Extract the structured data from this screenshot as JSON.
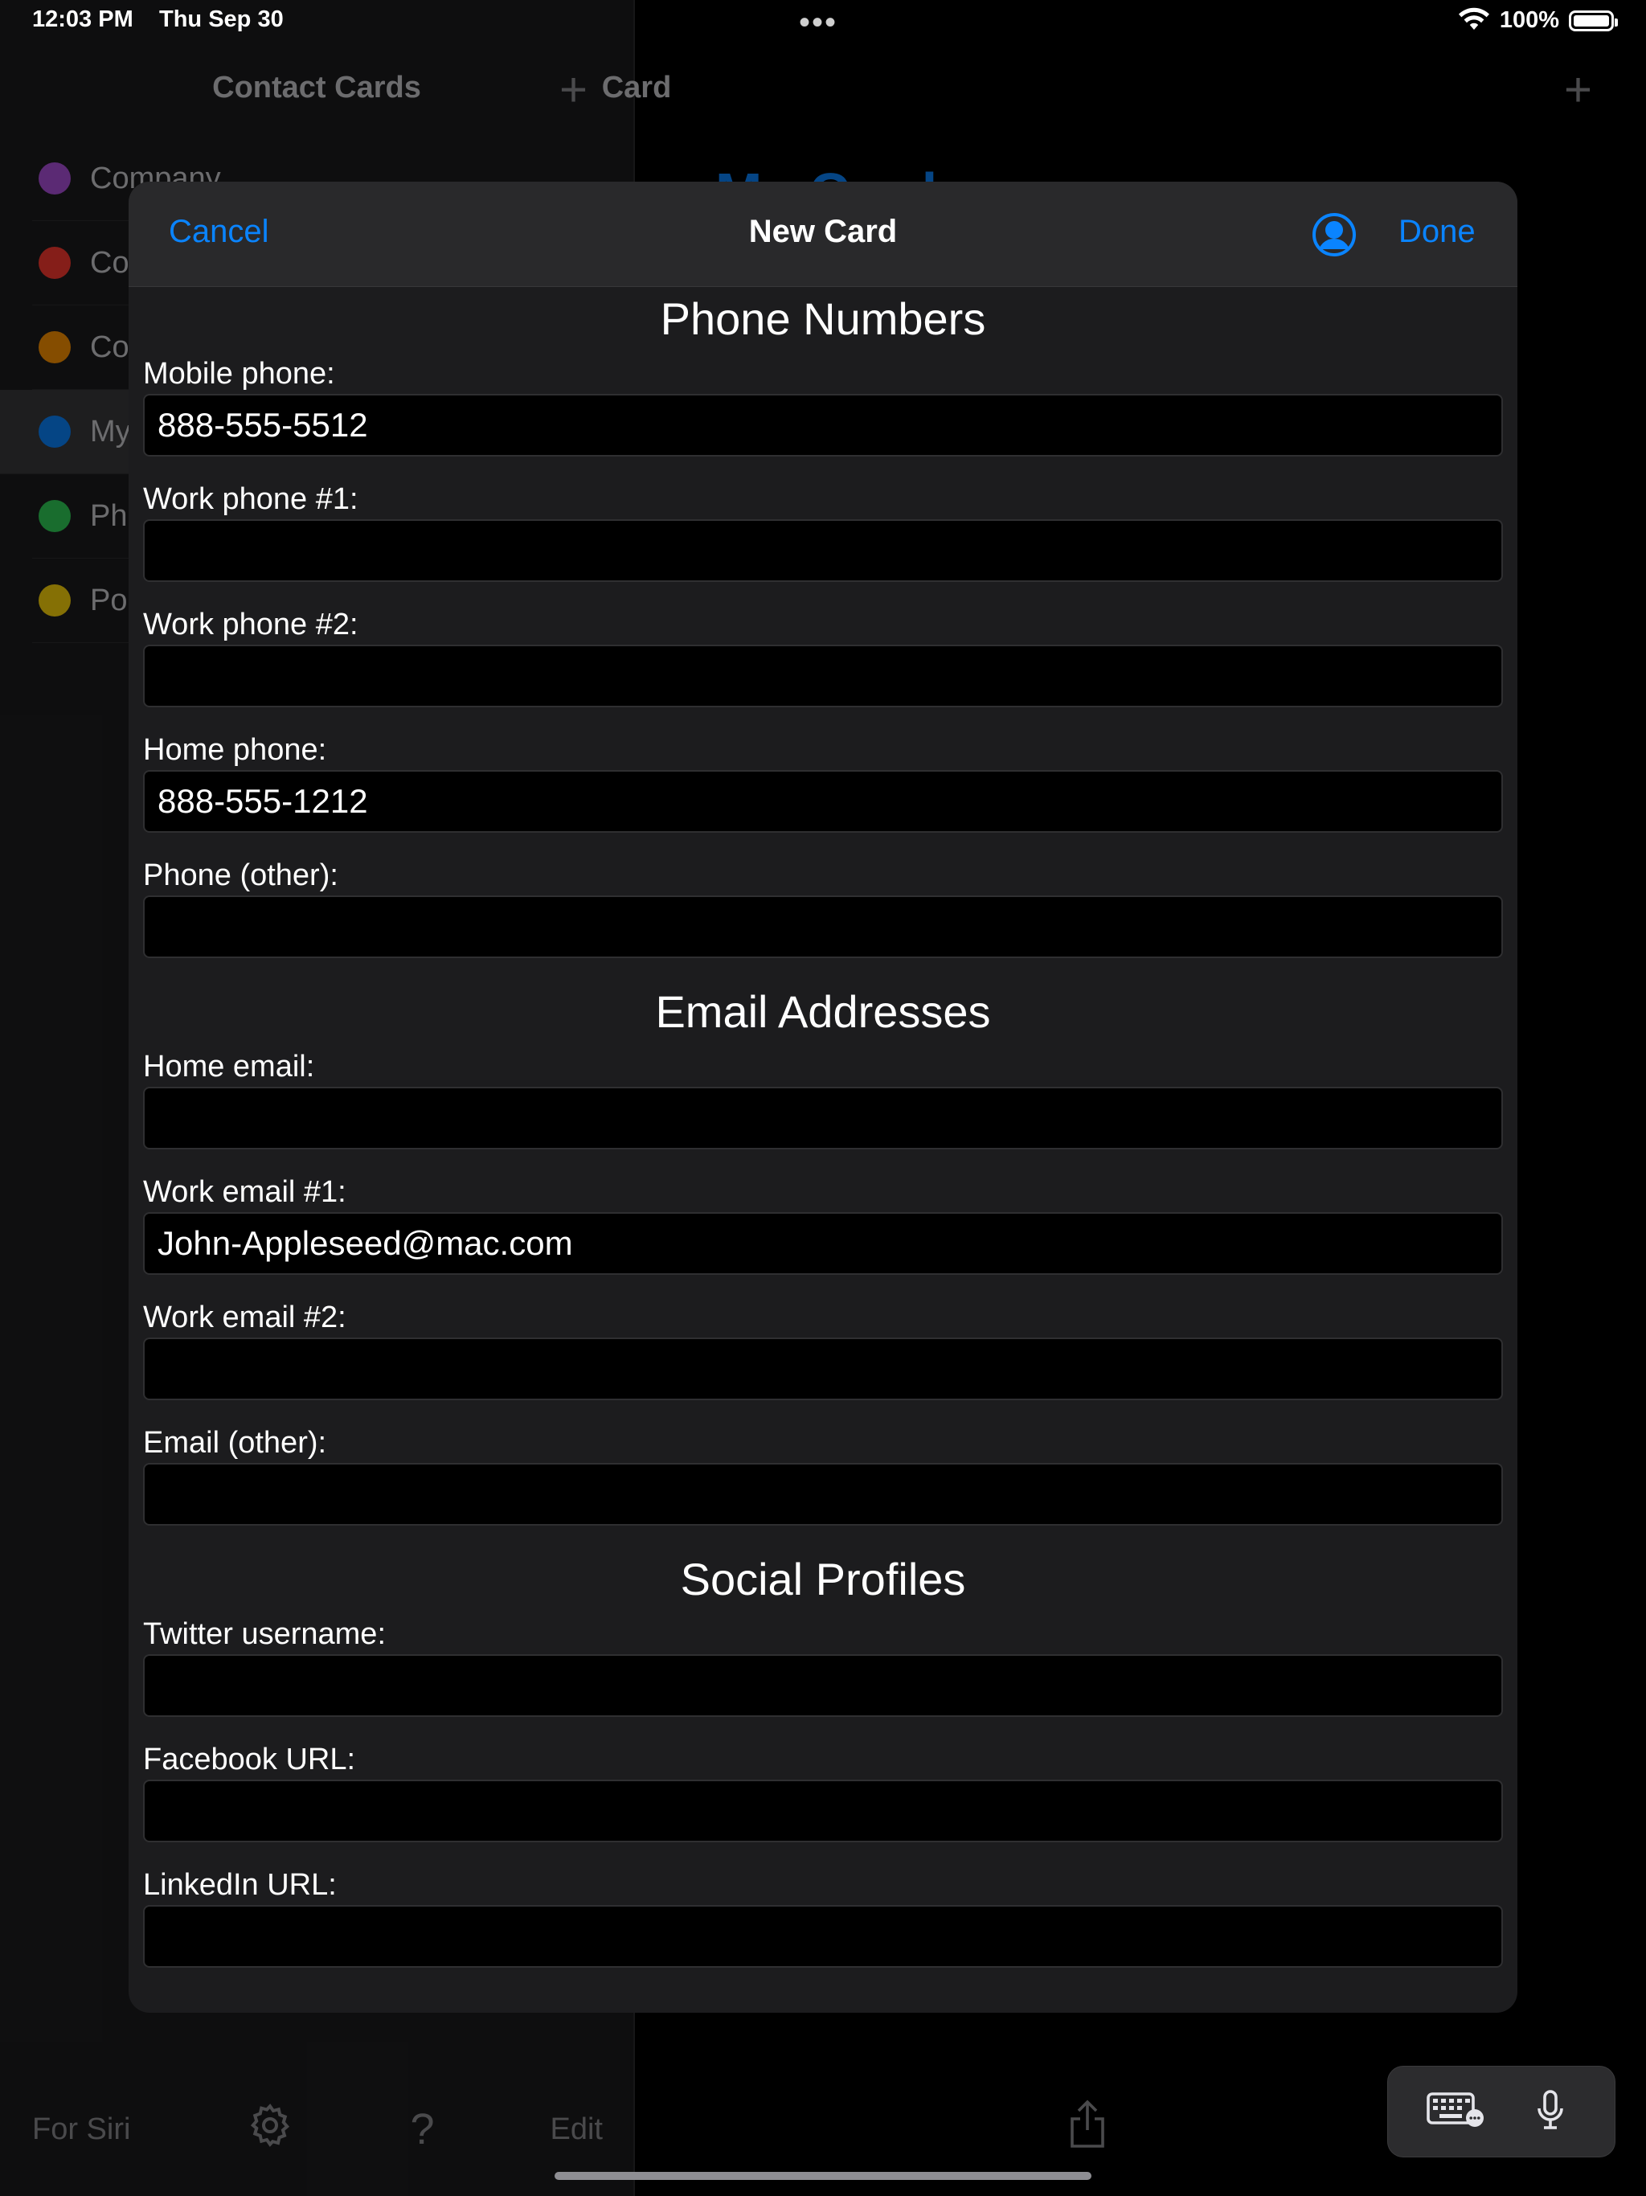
{
  "status_bar": {
    "time": "12:03 PM",
    "date": "Thu Sep 30",
    "battery": "100%",
    "battery_level": 1.0
  },
  "sidebar": {
    "title": "Contact Cards",
    "items": [
      {
        "label": "Company",
        "color": "#af52de"
      },
      {
        "label": "Co",
        "color": "#ff3b30"
      },
      {
        "label": "Co",
        "color": "#ff9500"
      },
      {
        "label": "My",
        "color": "#0a84ff"
      },
      {
        "label": "Ph",
        "color": "#30d158"
      },
      {
        "label": "Po",
        "color": "#ffd60a"
      }
    ],
    "footer": {
      "siri_label": "For Siri",
      "edit_label": "Edit"
    }
  },
  "detail": {
    "title": "Card",
    "heading": "My Card"
  },
  "modal": {
    "cancel_label": "Cancel",
    "title": "New Card",
    "done_label": "Done",
    "sections": {
      "phone": {
        "title": "Phone Numbers",
        "fields": [
          {
            "label": "Mobile phone:",
            "value": "888-555-5512"
          },
          {
            "label": "Work phone #1:",
            "value": ""
          },
          {
            "label": "Work phone #2:",
            "value": ""
          },
          {
            "label": "Home phone:",
            "value": "888-555-1212"
          },
          {
            "label": "Phone (other):",
            "value": ""
          }
        ]
      },
      "email": {
        "title": "Email Addresses",
        "fields": [
          {
            "label": "Home email:",
            "value": ""
          },
          {
            "label": "Work email #1:",
            "value": "John-Appleseed@mac.com"
          },
          {
            "label": "Work email #2:",
            "value": ""
          },
          {
            "label": "Email (other):",
            "value": ""
          }
        ]
      },
      "social": {
        "title": "Social Profiles",
        "fields": [
          {
            "label": "Twitter username:",
            "value": ""
          },
          {
            "label": "Facebook URL:",
            "value": ""
          },
          {
            "label": "LinkedIn URL:",
            "value": ""
          }
        ]
      }
    }
  },
  "colors": {
    "accent": "#0a84ff",
    "background": "#000000",
    "modal": "#1c1c1e"
  }
}
